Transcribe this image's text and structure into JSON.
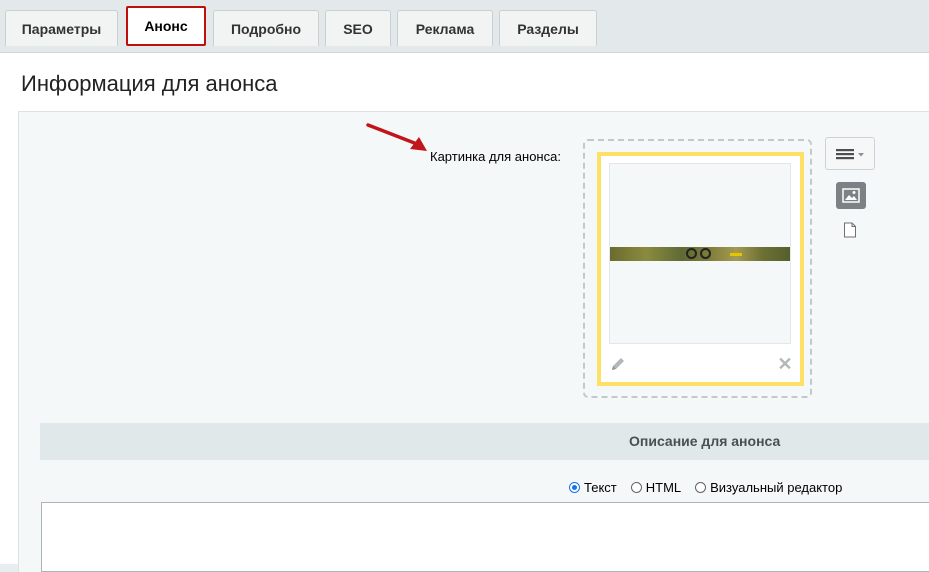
{
  "tabs": [
    {
      "label": "Параметры",
      "active": false
    },
    {
      "label": "Анонс",
      "active": true
    },
    {
      "label": "Подробно",
      "active": false
    },
    {
      "label": "SEO",
      "active": false
    },
    {
      "label": "Реклама",
      "active": false
    },
    {
      "label": "Разделы",
      "active": false
    }
  ],
  "page": {
    "title": "Информация для анонса"
  },
  "preview_picture": {
    "label": "Картинка для анонса:"
  },
  "description": {
    "header": "Описание для анонса",
    "modes": [
      {
        "label": "Текст",
        "checked": true
      },
      {
        "label": "HTML",
        "checked": false
      },
      {
        "label": "Визуальный редактор",
        "checked": false
      }
    ],
    "value": ""
  },
  "icons": {
    "annotation": "red-arrow-icon",
    "menu": "hamburger-menu-icon",
    "image_mode": "image-icon",
    "file_mode": "file-icon",
    "edit": "pencil-icon",
    "delete": "close-icon"
  },
  "colors": {
    "active_tab_border": "#c00d0d",
    "image_card_border": "#ffe066",
    "radio_checked": "#1a73e8"
  }
}
